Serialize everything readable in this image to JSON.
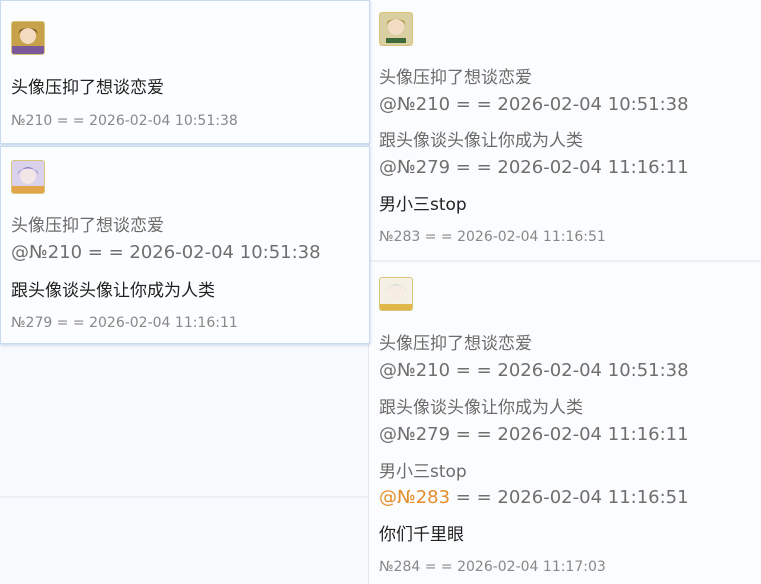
{
  "left_top_post": {
    "avatar": "avatar-anime-gold-icon",
    "body": "头像压抑了想谈恋爱",
    "meta": "№210 = = 2026-02-04 10:51:38"
  },
  "left_popup_post": {
    "avatar": "avatar-anime-purple-icon",
    "quote_text_1": "头像压抑了想谈恋爱",
    "quote_ref_1": "@№210 = = 2026-02-04 10:51:38",
    "body": "跟头像谈头像让你成为人类",
    "meta": "№279 = = 2026-02-04 11:16:11"
  },
  "right_top_post": {
    "avatar": "avatar-anime-green-icon",
    "quote_text_1": "头像压抑了想谈恋爱",
    "quote_ref_1": "@№210 = = 2026-02-04 10:51:38",
    "quote_text_2": "跟头像谈头像让你成为人类",
    "quote_ref_2": "@№279 = = 2026-02-04 11:16:11",
    "body": "男小三stop",
    "meta": "№283 = = 2026-02-04 11:16:51"
  },
  "right_bottom_post": {
    "avatar": "avatar-anime-white-icon",
    "quote_text_1": "头像压抑了想谈恋爱",
    "quote_ref_1": "@№210 = = 2026-02-04 10:51:38",
    "quote_text_2": "跟头像谈头像让你成为人类",
    "quote_ref_2": "@№279 = = 2026-02-04 11:16:11",
    "quote_text_3": "男小三stop",
    "quote_ref_3": "@№283",
    "quote_ref_3_rest": " = = 2026-02-04 11:16:51",
    "body": "你们千里眼",
    "meta": "№284 = = 2026-02-04 11:17:03"
  },
  "colors": {
    "highlight": "#e58d2a",
    "card_border": "#c7dcf3",
    "meta_text": "#888888"
  }
}
